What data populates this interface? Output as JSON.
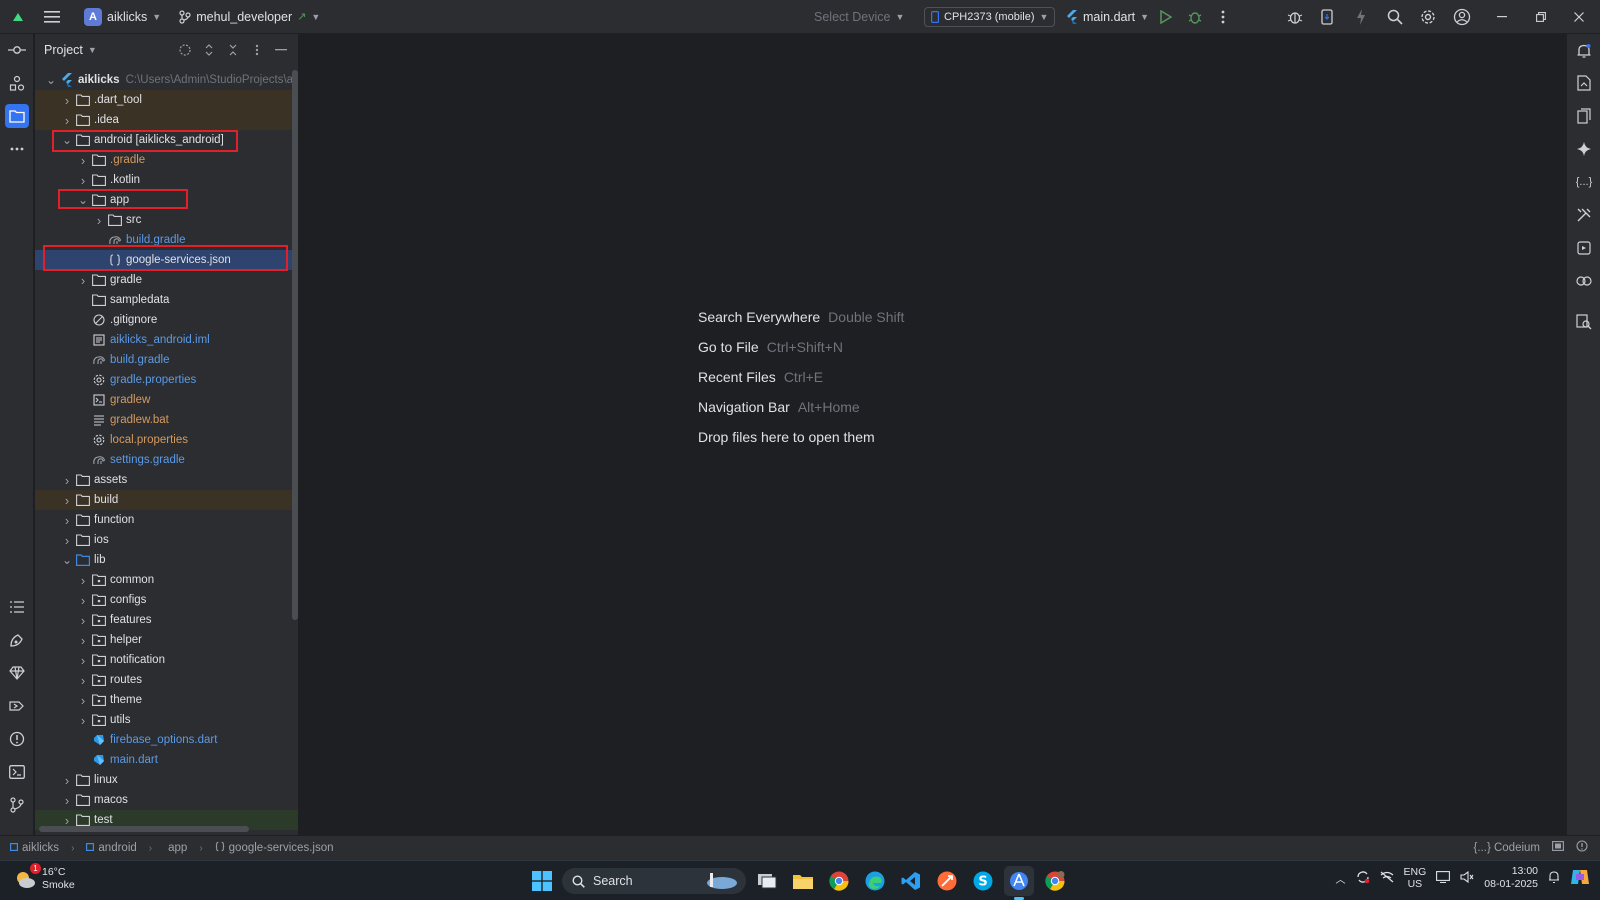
{
  "titlebar": {
    "project_initial": "A",
    "project_name": "aiklicks",
    "branch": "mehul_developer",
    "branch_arrow": "↗",
    "select_device": "Select Device",
    "device": "CPH2373 (mobile)",
    "run_config": "main.dart"
  },
  "panel": {
    "title": "Project"
  },
  "tree": [
    {
      "label": "aiklicks",
      "hint": "C:\\Users\\Admin\\StudioProjects\\aik",
      "depth": 0,
      "arrow": "open",
      "icon": "module-icon",
      "style": "",
      "bg": ""
    },
    {
      "label": ".dart_tool",
      "depth": 1,
      "arrow": "closed",
      "icon": "folder-icon",
      "style": "",
      "bg": "excluded"
    },
    {
      "label": ".idea",
      "depth": 1,
      "arrow": "closed",
      "icon": "folder-icon",
      "style": "",
      "bg": "excluded"
    },
    {
      "label": "android [aiklicks_android]",
      "depth": 1,
      "arrow": "open",
      "icon": "folder-icon",
      "style": "",
      "bg": ""
    },
    {
      "label": ".gradle",
      "depth": 2,
      "arrow": "closed",
      "icon": "folder-icon",
      "style": "orange",
      "bg": ""
    },
    {
      "label": ".kotlin",
      "depth": 2,
      "arrow": "closed",
      "icon": "folder-icon",
      "style": "",
      "bg": ""
    },
    {
      "label": "app",
      "depth": 2,
      "arrow": "open",
      "icon": "folder-icon",
      "style": "",
      "bg": ""
    },
    {
      "label": "src",
      "depth": 3,
      "arrow": "closed",
      "icon": "folder-icon",
      "style": "",
      "bg": ""
    },
    {
      "label": "build.gradle",
      "depth": 3,
      "arrow": "none",
      "icon": "gradle-icon",
      "style": "blue",
      "bg": ""
    },
    {
      "label": "google-services.json",
      "depth": 3,
      "arrow": "none",
      "icon": "json-icon",
      "style": "",
      "bg": "selected"
    },
    {
      "label": "gradle",
      "depth": 2,
      "arrow": "closed",
      "icon": "folder-icon",
      "style": "",
      "bg": ""
    },
    {
      "label": "sampledata",
      "depth": 2,
      "arrow": "none",
      "icon": "folder-icon",
      "style": "",
      "bg": ""
    },
    {
      "label": ".gitignore",
      "depth": 2,
      "arrow": "none",
      "icon": "ignore-icon",
      "style": "",
      "bg": ""
    },
    {
      "label": "aiklicks_android.iml",
      "depth": 2,
      "arrow": "none",
      "icon": "file-icon",
      "style": "blue",
      "bg": ""
    },
    {
      "label": "build.gradle",
      "depth": 2,
      "arrow": "none",
      "icon": "gradle-icon",
      "style": "blue",
      "bg": ""
    },
    {
      "label": "gradle.properties",
      "depth": 2,
      "arrow": "none",
      "icon": "settings-file-icon",
      "style": "blue",
      "bg": ""
    },
    {
      "label": "gradlew",
      "depth": 2,
      "arrow": "none",
      "icon": "script-icon",
      "style": "orange",
      "bg": ""
    },
    {
      "label": "gradlew.bat",
      "depth": 2,
      "arrow": "none",
      "icon": "text-file-icon",
      "style": "orange",
      "bg": ""
    },
    {
      "label": "local.properties",
      "depth": 2,
      "arrow": "none",
      "icon": "settings-file-icon",
      "style": "orange",
      "bg": ""
    },
    {
      "label": "settings.gradle",
      "depth": 2,
      "arrow": "none",
      "icon": "gradle-icon",
      "style": "blue",
      "bg": ""
    },
    {
      "label": "assets",
      "depth": 1,
      "arrow": "closed",
      "icon": "folder-icon",
      "style": "",
      "bg": ""
    },
    {
      "label": "build",
      "depth": 1,
      "arrow": "closed",
      "icon": "folder-icon",
      "style": "",
      "bg": "excluded"
    },
    {
      "label": "function",
      "depth": 1,
      "arrow": "closed",
      "icon": "folder-icon",
      "style": "",
      "bg": ""
    },
    {
      "label": "ios",
      "depth": 1,
      "arrow": "closed",
      "icon": "folder-icon",
      "style": "",
      "bg": ""
    },
    {
      "label": "lib",
      "depth": 1,
      "arrow": "open",
      "icon": "source-folder-icon",
      "style": "",
      "bg": ""
    },
    {
      "label": "common",
      "depth": 2,
      "arrow": "closed",
      "icon": "package-icon",
      "style": "",
      "bg": ""
    },
    {
      "label": "configs",
      "depth": 2,
      "arrow": "closed",
      "icon": "package-icon",
      "style": "",
      "bg": ""
    },
    {
      "label": "features",
      "depth": 2,
      "arrow": "closed",
      "icon": "package-icon",
      "style": "",
      "bg": ""
    },
    {
      "label": "helper",
      "depth": 2,
      "arrow": "closed",
      "icon": "package-icon",
      "style": "",
      "bg": ""
    },
    {
      "label": "notification",
      "depth": 2,
      "arrow": "closed",
      "icon": "package-icon",
      "style": "",
      "bg": ""
    },
    {
      "label": "routes",
      "depth": 2,
      "arrow": "closed",
      "icon": "package-icon",
      "style": "",
      "bg": ""
    },
    {
      "label": "theme",
      "depth": 2,
      "arrow": "closed",
      "icon": "package-icon",
      "style": "",
      "bg": ""
    },
    {
      "label": "utils",
      "depth": 2,
      "arrow": "closed",
      "icon": "package-icon",
      "style": "",
      "bg": ""
    },
    {
      "label": "firebase_options.dart",
      "depth": 2,
      "arrow": "none",
      "icon": "dart-icon",
      "style": "blue",
      "bg": ""
    },
    {
      "label": "main.dart",
      "depth": 2,
      "arrow": "none",
      "icon": "dart-icon",
      "style": "blue",
      "bg": ""
    },
    {
      "label": "linux",
      "depth": 1,
      "arrow": "closed",
      "icon": "folder-icon",
      "style": "",
      "bg": ""
    },
    {
      "label": "macos",
      "depth": 1,
      "arrow": "closed",
      "icon": "folder-icon",
      "style": "",
      "bg": ""
    },
    {
      "label": "test",
      "depth": 1,
      "arrow": "closed",
      "icon": "folder-icon",
      "style": "",
      "bg": "gen"
    }
  ],
  "editor_hints": [
    {
      "action": "Search Everywhere",
      "shortcut": "Double Shift"
    },
    {
      "action": "Go to File",
      "shortcut": "Ctrl+Shift+N"
    },
    {
      "action": "Recent Files",
      "shortcut": "Ctrl+E"
    },
    {
      "action": "Navigation Bar",
      "shortcut": "Alt+Home"
    },
    {
      "action": "Drop files here to open them",
      "shortcut": ""
    }
  ],
  "statusbar": {
    "crumbs": [
      "aiklicks",
      "android",
      "app",
      "google-services.json"
    ],
    "plugin": "{...} Codeium"
  },
  "taskbar": {
    "weather_temp": "16°C",
    "weather_desc": "Smoke",
    "weather_badge": "1",
    "search_label": "Search",
    "lang_top": "ENG",
    "lang_bottom": "US",
    "time": "13:00",
    "date": "08-01-2025"
  },
  "colors": {
    "accent": "#3574f0",
    "selection": "#2e436e",
    "excluded_bg": "#3b3226",
    "highlight_box": "#e0202a"
  }
}
